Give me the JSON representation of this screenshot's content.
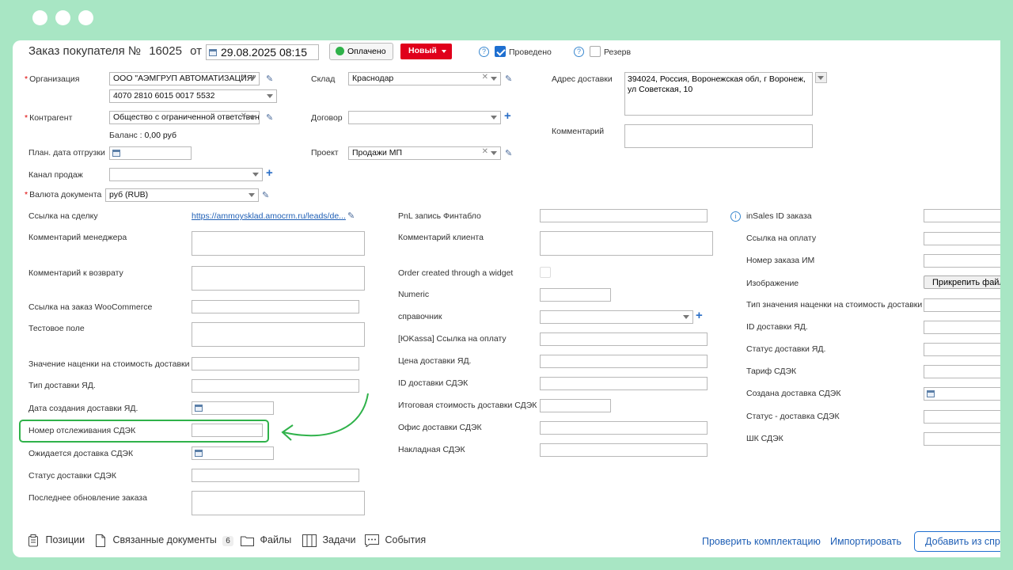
{
  "header": {
    "title": "Заказ покупателя №",
    "number": "16025",
    "from": "от",
    "date": "29.08.2025 08:15",
    "paid_label": "Оплачено",
    "status_label": "Новый",
    "posted_label": "Проведено",
    "reserve_label": "Резерв"
  },
  "top": {
    "org_label": "Организация",
    "org_value": "ООО \"АЭМГРУП АВТОМАТИЗАЦИЯ\"",
    "account_value": "4070 2810 6015 0017 5532",
    "counterparty_label": "Контрагент",
    "counterparty_value": "Общество с ограниченной ответственностью",
    "balance_label": "Баланс :",
    "balance_value": "0,00 руб",
    "ship_date_label": "План. дата отгрузки",
    "channel_label": "Канал продаж",
    "currency_label": "Валюта документа",
    "currency_value": "руб (RUB)",
    "warehouse_label": "Склад",
    "warehouse_value": "Краснодар",
    "contract_label": "Договор",
    "project_label": "Проект",
    "project_value": "Продажи МП",
    "address_label": "Адрес доставки",
    "address_value": "394024, Россия, Воронежская обл, г Воронеж, ул Советская, 10",
    "comment_label": "Комментарий"
  },
  "col1": {
    "deal_link_label": "Ссылка на сделку",
    "deal_link_value": "https://ammoysklad.amocrm.ru/leads/de...",
    "manager_comment": "Комментарий менеджера",
    "return_comment": "Комментарий к возврату",
    "woo_link": "Ссылка на заказ WooCommerce",
    "test_field": "Тестовое поле",
    "markup_value": "Значение наценки на стоимость доставки",
    "yd_type": "Тип доставки ЯД.",
    "yd_created": "Дата создания доставки ЯД.",
    "cdek_tracking": "Номер отслеживания СДЭК",
    "cdek_expected": "Ожидается доставка СДЭК",
    "cdek_status": "Статус доставки СДЭК",
    "last_update": "Последнее обновление заказа"
  },
  "col2": {
    "pnl": "PnL запись Финтабло",
    "client_comment": "Комментарий клиента",
    "widget": "Order created through a widget",
    "numeric": "Numeric",
    "directory": "справочник",
    "yookassa": "[ЮKassa] Ссылка на оплату",
    "yd_price": "Цена доставки ЯД.",
    "cdek_id": "ID доставки СДЭК",
    "cdek_total": "Итоговая стоимость доставки СДЭК",
    "cdek_office": "Офис доставки СДЭК",
    "cdek_waybill": "Накладная СДЭК"
  },
  "col3": {
    "insales_id": "inSales ID заказа",
    "pay_link": "Ссылка на оплату",
    "im_number": "Номер заказа ИМ",
    "image": "Изображение",
    "attach_button": "Прикрепить файл",
    "markup_type": "Тип значения наценки на стоимость доставки",
    "yd_id": "ID доставки ЯД.",
    "yd_status": "Статус доставки ЯД.",
    "cdek_tariff": "Тариф СДЭК",
    "cdek_created": "Создана доставка СДЭК",
    "cdek_status2": "Статус - доставка СДЭК",
    "cdek_barcode": "ШК СДЭК"
  },
  "footer": {
    "positions": "Позиции",
    "related_docs": "Связанные документы",
    "related_count": "6",
    "files": "Файлы",
    "tasks": "Задачи",
    "events": "События",
    "check_kit": "Проверить комплектацию",
    "import": "Импортировать",
    "add_from": "Добавить из справочника"
  },
  "colors": {
    "accent_green": "#2fb24a",
    "status_red": "#e0001b",
    "link_blue": "#1f5fb5"
  }
}
